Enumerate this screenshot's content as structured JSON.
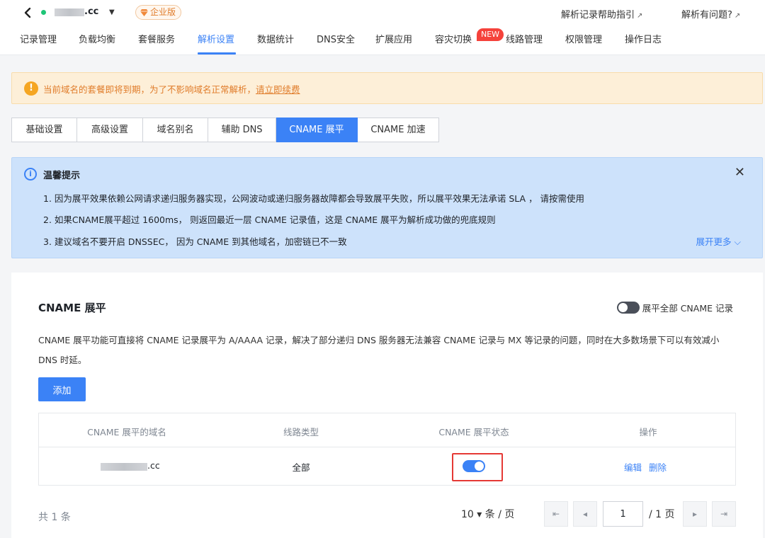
{
  "header": {
    "domain_suffix": ".cc",
    "edition_badge": "企业版",
    "help_links": [
      {
        "label": "解析记录帮助指引",
        "ext": "↗"
      },
      {
        "label": "解析有问题?",
        "ext": "↗"
      }
    ]
  },
  "nav": {
    "items": [
      "记录管理",
      "负载均衡",
      "套餐服务",
      "解析设置",
      "数据统计",
      "DNS安全",
      "扩展应用",
      "容灾切换",
      "线路管理",
      "权限管理",
      "操作日志"
    ],
    "active": "解析设置",
    "new_badge": "NEW"
  },
  "warning": {
    "icon": "!",
    "text": "当前域名的套餐即将到期，为了不影响域名正常解析，",
    "link": "请立即续费"
  },
  "subtabs": {
    "items": [
      "基础设置",
      "高级设置",
      "域名别名",
      "辅助 DNS",
      "CNAME 展平",
      "CNAME 加速"
    ],
    "active": "CNAME 展平"
  },
  "notice": {
    "icon": "i",
    "title": "温馨提示",
    "close": "✕",
    "lines": [
      "1. 因为展平效果依赖公网请求递归服务器实现，公网波动或递归服务器故障都会导致展平失败，所以展平效果无法承诺 SLA ， 请按需使用",
      "2. 如果CNAME展平超过 1600ms， 则返回最近一层 CNAME 记录值，这是 CNAME 展平为解析成功做的兜底规则",
      "3. 建议域名不要开启 DNSSEC， 因为 CNAME 到其他域名，加密链已不一致"
    ],
    "more": "展开更多 ⌵"
  },
  "card": {
    "title": "CNAME 展平",
    "toggle_all_label": "展平全部 CNAME 记录",
    "toggle_all_on": false,
    "description": "CNAME 展平功能可直接将 CNAME 记录展平为 A/AAAA 记录，解决了部分递归 DNS 服务器无法兼容 CNAME 记录与 MX 等记录的问题，同时在大多数场景下可以有效减小 DNS 时延。",
    "add_button": "添加"
  },
  "table": {
    "columns": [
      "CNAME 展平的域名",
      "线路类型",
      "CNAME 展平状态",
      "操作"
    ],
    "rows": [
      {
        "domain_suffix": ".cc",
        "line": "全部",
        "status_on": true,
        "actions": [
          "编辑",
          "删除"
        ]
      }
    ]
  },
  "pagination": {
    "total": "共 1 条",
    "page_size": "10 ▾",
    "page_size_unit": "条 / 页",
    "current_page": "1",
    "total_pages": "/ 1 页",
    "first": "⇤",
    "prev": "◂",
    "next": "▸",
    "last": "⇥"
  },
  "colors": {
    "accent": "#3b82f6",
    "warning": "#e07c2a",
    "highlight_border": "#e53935",
    "new_badge": "#f5423b"
  }
}
